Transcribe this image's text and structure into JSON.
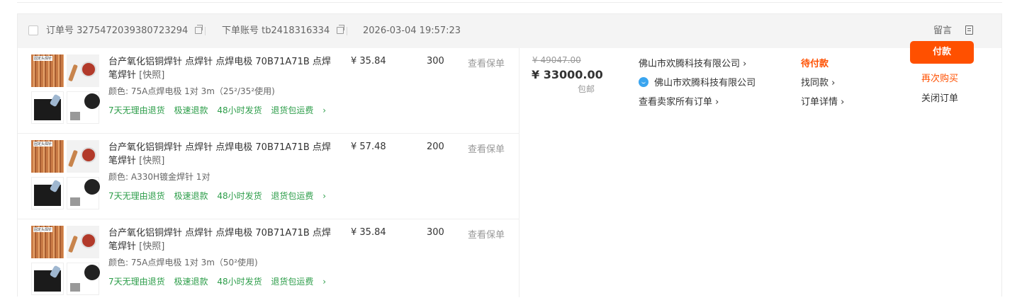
{
  "order": {
    "order_no_label": "订单号",
    "order_no": "3275472039380723294",
    "account_label": "下单账号",
    "account": "tb2418316334",
    "time": "2026-03-04 19:57:23",
    "message_label": "留言"
  },
  "items": [
    {
      "thumb_text": "固定头焊针",
      "title": "台产氧化铝铜焊针 点焊针 点焊电极 70B71A71B 点焊笔焊针",
      "title_suffix": "[快照]",
      "spec": "颜色: 75A点焊电极 1对 3m（25²/35²使用)",
      "unit_price": "¥ 35.84",
      "qty": "300",
      "policy": "查看保单",
      "tags": [
        "7天无理由退货",
        "极速退款",
        "48小时发货",
        "退货包运费"
      ]
    },
    {
      "thumb_text": "固定头焊针",
      "title": "台产氧化铝铜焊针 点焊针 点焊电极 70B71A71B 点焊笔焊针",
      "title_suffix": "[快照]",
      "spec": "颜色: A330H镀金焊针 1对",
      "unit_price": "¥ 57.48",
      "qty": "200",
      "policy": "查看保单",
      "tags": [
        "7天无理由退货",
        "极速退款",
        "48小时发货",
        "退货包运费"
      ]
    },
    {
      "thumb_text": "固定头焊针",
      "title": "台产氧化铝铜焊针 点焊针 点焊电极 70B71A71B 点焊笔焊针",
      "title_suffix": "[快照]",
      "spec": "颜色: 75A点焊电极 1对 3m（50²使用)",
      "unit_price": "¥ 35.84",
      "qty": "300",
      "policy": "查看保单",
      "tags": [
        "7天无理由退货",
        "极速退款",
        "48小时发货",
        "退货包运费"
      ]
    }
  ],
  "payment": {
    "original_price": "¥ 49047.00",
    "total_price": "¥ 33000.00",
    "shipping": "包邮"
  },
  "shop": {
    "name": "佛山市欢腾科技有限公司",
    "im_name": "佛山市欢腾科技有限公司",
    "all_orders": "查看卖家所有订单"
  },
  "status": {
    "text": "待付款",
    "find_same": "找同款",
    "detail": "订单详情"
  },
  "actions": {
    "pay": "付款",
    "rebuy": "再次购买",
    "close": "关闭订单"
  },
  "colors": {
    "accent": "#ff5000",
    "tag_green": "#2c9d49",
    "header_bg": "#f4f4f4",
    "im_blue": "#3aa5ef"
  },
  "icons": [
    "copy-icon",
    "chevron-right-icon",
    "wangwang-chat-icon",
    "note-icon",
    "checkbox"
  ]
}
